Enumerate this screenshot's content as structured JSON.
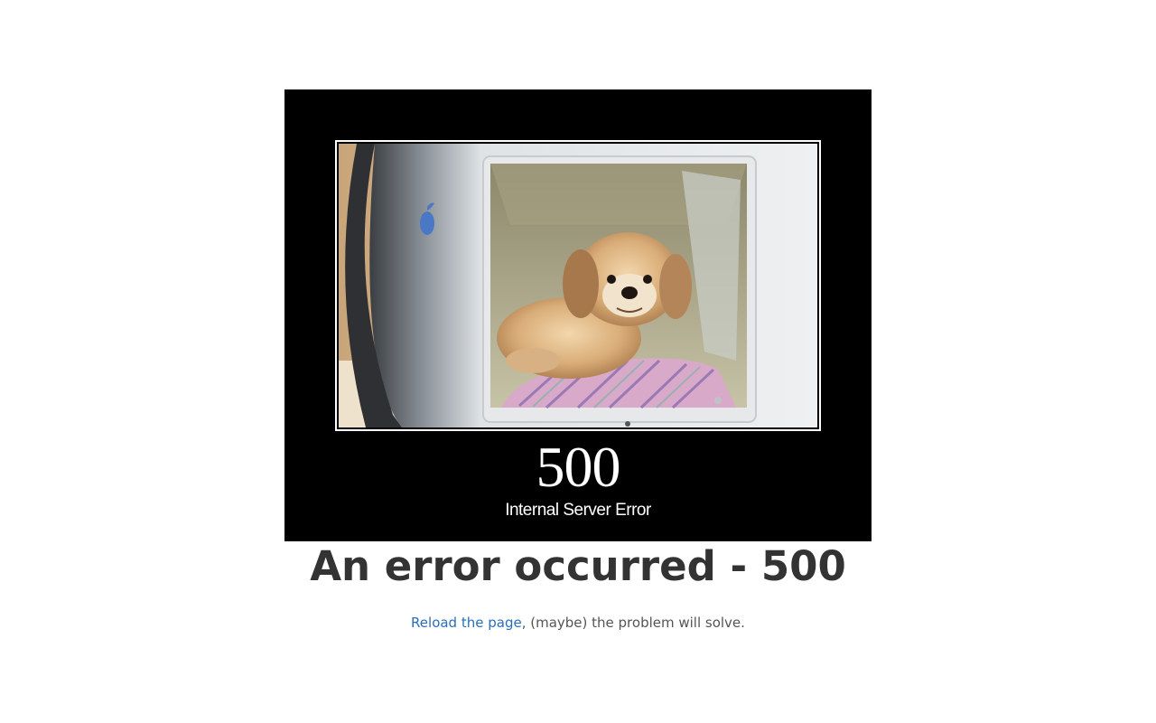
{
  "error_image": {
    "code": "500",
    "status": "Internal Server Error"
  },
  "main": {
    "headline": "An error occurred - 500",
    "reload_link": "Reload the page",
    "message_suffix": ", (maybe) the problem will solve."
  },
  "colors": {
    "headline": "#333333",
    "link": "#2a6ebb",
    "text": "#555555",
    "image_background": "#000000"
  }
}
